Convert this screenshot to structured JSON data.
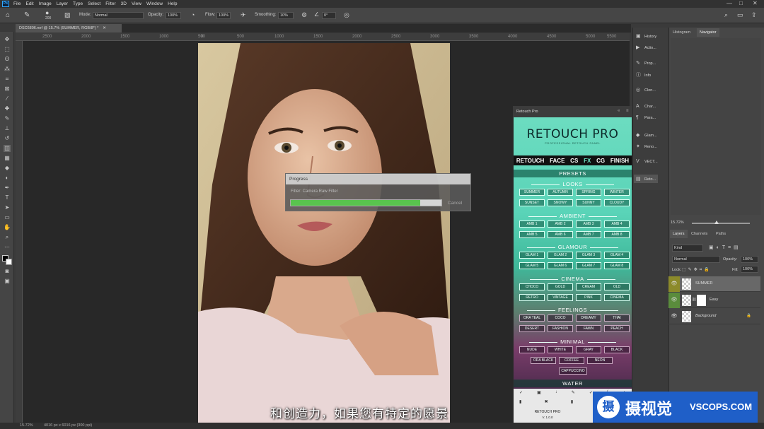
{
  "menubar": {
    "items": [
      "File",
      "Edit",
      "Image",
      "Layer",
      "Type",
      "Select",
      "Filter",
      "3D",
      "View",
      "Window",
      "Help"
    ],
    "app_icon": "Ps"
  },
  "options": {
    "brush_size": "200",
    "mode_label": "Mode:",
    "mode_value": "Normal",
    "opacity_label": "Opacity:",
    "opacity_value": "100%",
    "flow_label": "Flow:",
    "flow_value": "100%",
    "smoothing_label": "Smoothing:",
    "smoothing_value": "10%",
    "angle_value": "0°"
  },
  "document": {
    "tab_title": "DSC6806.nef @ 15.7% (SUMMER, RGB/8*) *",
    "zoom": "15.72%",
    "info": "4016 px x 6016 px (300 ppi)"
  },
  "ruler": {
    "ticks": [
      "2500",
      "2000",
      "1500",
      "1000",
      "500",
      "0",
      "500",
      "1000",
      "1500",
      "2000",
      "2500",
      "3000",
      "3500",
      "4000",
      "4500",
      "5000",
      "5500",
      "6000",
      "6500"
    ]
  },
  "progress": {
    "title": "Progress",
    "filter": "Filter: Camera Raw Filter",
    "value": 0.86,
    "cancel": "Cancel"
  },
  "subtitle": "和创造力，如果您有特定的愿景",
  "dock": {
    "items": [
      {
        "icon": "▣",
        "label": "History"
      },
      {
        "icon": "▶",
        "label": "Actio..."
      },
      {
        "icon": "✎",
        "label": "Prop..."
      },
      {
        "icon": "ⓘ",
        "label": "Info"
      },
      {
        "icon": "◎",
        "label": "Clon..."
      },
      {
        "icon": "A",
        "label": "Char..."
      },
      {
        "icon": "¶",
        "label": "Para..."
      },
      {
        "icon": "◆",
        "label": "Glam..."
      },
      {
        "icon": "✦",
        "label": "Reno..."
      },
      {
        "icon": "V",
        "label": "VECT..."
      },
      {
        "icon": "▤",
        "label": "Reto..."
      }
    ]
  },
  "rightpanel": {
    "tabs_top": [
      "Histogram",
      "Navigator"
    ],
    "tabs_layers": [
      "Layers",
      "Channels",
      "Paths"
    ],
    "nav_zoom": "15.72%",
    "kind": "Kind",
    "blend": "Normal",
    "opacity_label": "Opacity:",
    "opacity": "100%",
    "lock_label": "Lock:",
    "fill_label": "Fill:",
    "fill": "100%"
  },
  "layers": [
    {
      "name": "SUMMER"
    },
    {
      "name": "Easy"
    },
    {
      "name": "Background"
    }
  ],
  "retouch": {
    "panel_title": "Retouch Pro",
    "logo": "RETOUCH PRO",
    "tagline": "PROFESSIONAL RETOUCH PANEL",
    "tabs": [
      "RETOUCH",
      "FACE",
      "CS",
      "FX",
      "CG",
      "FINISH"
    ],
    "active_tab": "FX",
    "presets": "PRESETS",
    "sections": [
      {
        "title": "LOOKS",
        "buttons": [
          "SUMMER",
          "AUTUMN",
          "SPRING",
          "WINTER",
          "SUNSET",
          "SNOWY",
          "SUNNY",
          "CLOUDY"
        ]
      },
      {
        "title": "AMBIENT",
        "buttons": [
          "AMB 1",
          "AMB 2",
          "AMB 3",
          "AMB 4",
          "AMB 5",
          "AMB 6",
          "AMB 7",
          "AMB 8"
        ]
      },
      {
        "title": "GLAMOUR",
        "buttons": [
          "GLAM 1",
          "GLAM 2",
          "GLAM 3",
          "GLAM 4",
          "GLAM 5",
          "GLAM 6",
          "GLAM 7",
          "GLAM 8"
        ]
      },
      {
        "title": "CINEMA",
        "buttons": [
          "CHOCO",
          "GOLD",
          "CREAM",
          "OLD",
          "RETRO",
          "VINTAGE",
          "PINK",
          "CINEMA"
        ]
      },
      {
        "title": "FEELINGS",
        "buttons": [
          "ORA TEAL",
          "COCO",
          "DREAMY",
          "THAI",
          "DESERT",
          "FASHION",
          "FAWN",
          "PEACH"
        ]
      },
      {
        "title": "MINIMAL",
        "buttons": [
          "NUDE",
          "WHITE",
          "GRAY",
          "BLACK",
          "ORA BLACK",
          "COFFEE",
          "NEON",
          "CAPPUCCINO"
        ]
      }
    ],
    "water": "WATER",
    "footer_title": "RETOUCH PRO",
    "footer_version": "V. 1.0.0"
  },
  "watermark": {
    "logo": "摄",
    "cn": "摄视觉",
    "en": "VSCOPS.COM"
  }
}
